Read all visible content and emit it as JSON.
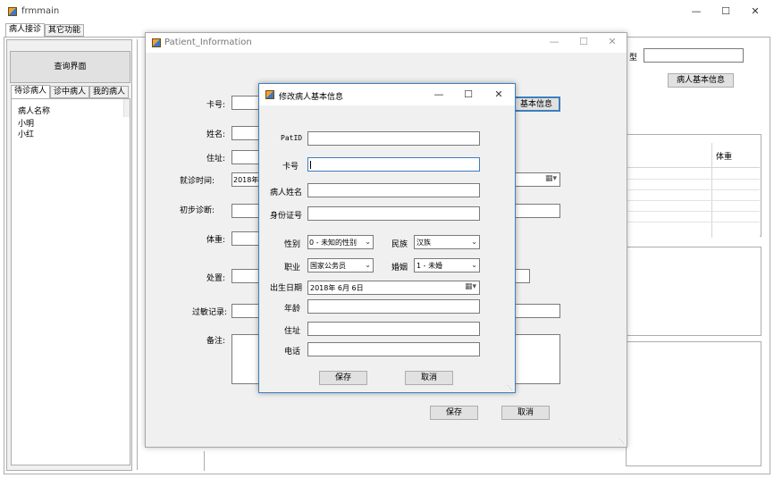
{
  "main_window": {
    "title": "frmmain",
    "tabs": [
      "病人接诊",
      "其它功能"
    ],
    "query_button": "查询界面",
    "patient_tabs": [
      "待诊病人",
      "诊中病人",
      "我的病人"
    ],
    "list_header": "病人名称",
    "patients": [
      "小明",
      "小红"
    ],
    "right_label_fragment": "型",
    "basic_info_button": "病人基本信息",
    "grid_header_weight": "体重"
  },
  "patient_window": {
    "title": "Patient_Information",
    "labels": {
      "card": "卡号:",
      "name": "姓名:",
      "address": "住址:",
      "visit_time": "就诊时间:",
      "diagnosis": "初步诊断:",
      "weight": "体重:",
      "treatment": "处置:",
      "allergy": "过敏记录:",
      "remark": "备注:"
    },
    "visit_time_value": "2018年",
    "basic_info_button": "基本信息",
    "save_button": "保存",
    "cancel_button": "取消"
  },
  "dialog": {
    "title": "修改病人基本信息",
    "labels": {
      "patid": "PatID",
      "card": "卡号",
      "name": "病人姓名",
      "idcard": "身份证号",
      "gender": "性别",
      "ethnicity": "民族",
      "job": "职业",
      "marriage": "婚姻",
      "birth": "出生日期",
      "age": "年龄",
      "address": "住址",
      "phone": "电话"
    },
    "values": {
      "gender": "0 - 未知的性别",
      "ethnicity": "汉族",
      "job": "国家公务员",
      "marriage": "1 - 未婚",
      "birth": "2018年 6月 6日"
    },
    "save_button": "保存",
    "cancel_button": "取消"
  },
  "caption_icons": [
    "minimize-icon",
    "maximize-icon",
    "close-icon"
  ]
}
